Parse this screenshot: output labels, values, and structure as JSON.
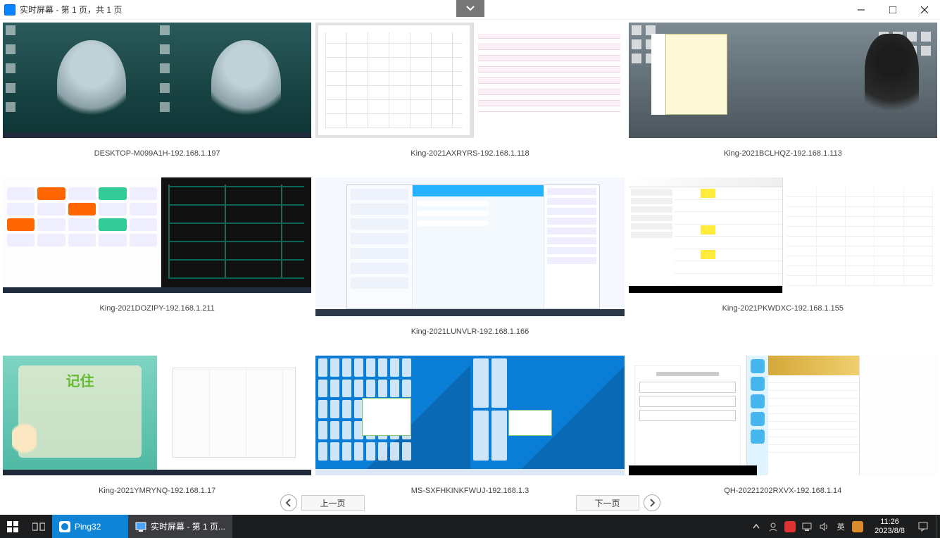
{
  "window": {
    "title": "实时屏幕 - 第 1 页，共 1 页"
  },
  "screens": [
    {
      "label": "DESKTOP-M099A1H-192.168.1.197"
    },
    {
      "label": "King-2021AXRYRS-192.168.1.118"
    },
    {
      "label": "King-2021BCLHQZ-192.168.1.113"
    },
    {
      "label": "King-2021DOZIPY-192.168.1.211"
    },
    {
      "label": "King-2021LUNVLR-192.168.1.166"
    },
    {
      "label": "King-2021PKWDXC-192.168.1.155"
    },
    {
      "label": "King-2021YMRYNQ-192.168.1.17"
    },
    {
      "label": "MS-SXFHKINKFWUJ-192.168.1.3"
    },
    {
      "label": "QH-20221202RXVX-192.168.1.14"
    }
  ],
  "pager": {
    "prev": "上一页",
    "next": "下一页"
  },
  "cartoon_title": "记住",
  "taskbar": {
    "app1": "Ping32",
    "app2": "实时屏幕 - 第 1 页...",
    "ime": "英",
    "time": "11:26",
    "date": "2023/8/8"
  },
  "tray_icons": [
    "hidden-icons",
    "security-icon",
    "jellyfin-icon",
    "network-icon",
    "volume-icon",
    "ime-lang",
    "sogou-icon"
  ]
}
